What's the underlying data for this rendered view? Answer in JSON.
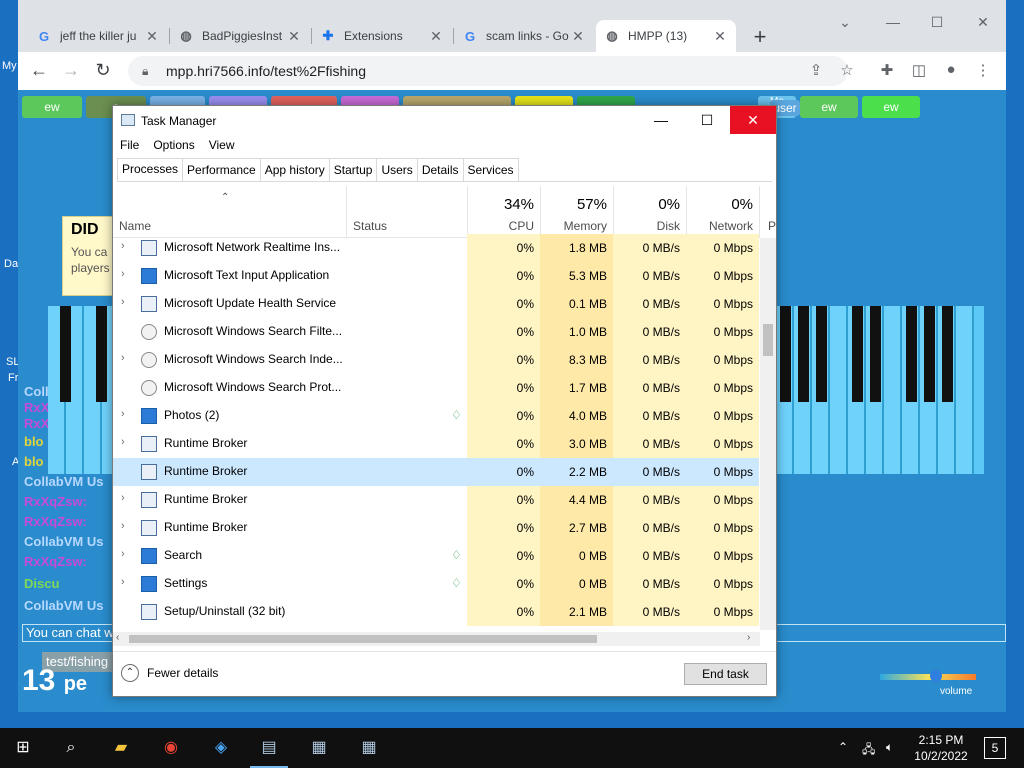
{
  "chrome": {
    "tabs": [
      {
        "title": "jeff the killer ju",
        "icon": "google-icon"
      },
      {
        "title": "BadPiggiesInst",
        "icon": "globe-icon"
      },
      {
        "title": "Extensions",
        "icon": "puzzle-icon"
      },
      {
        "title": "scam links - Go",
        "icon": "google-icon"
      },
      {
        "title": "HMPP (13)",
        "icon": "globe-icon"
      }
    ],
    "url": "mpp.hri7566.info/test%2Ffishing"
  },
  "page": {
    "top_buttons": [
      "ew",
      "e",
      "ew",
      "ew"
    ],
    "user_label": "Me",
    "user_button": "user",
    "chat_lines": [
      {
        "text": "CollabVM Us",
        "color": "#b7d8ff"
      },
      {
        "text": "RxXqZsw:",
        "color": "#c84bd8"
      },
      {
        "text": "RxXqZsw:",
        "color": "#c84bd8"
      },
      {
        "text": "blo",
        "color": "#e0d53a"
      },
      {
        "text": "blo",
        "color": "#e0d53a"
      },
      {
        "text": "blo",
        "color": "#e0d53a"
      },
      {
        "text": "CollabVM Us",
        "color": "#b7d8ff"
      },
      {
        "text": "RxXqZsw:",
        "color": "#c84bd8"
      },
      {
        "text": "RxXqZsw:",
        "color": "#c84bd8"
      },
      {
        "text": "CollabVM Us",
        "color": "#b7d8ff"
      },
      {
        "text": "RxXqZsw:",
        "color": "#c84bd8"
      },
      {
        "text": "Discu",
        "color": "#7ed957"
      },
      {
        "text": "CollabVM Us",
        "color": "#b7d8ff"
      }
    ],
    "popup_title": "DID",
    "popup_text_1": "You ca",
    "popup_text_2": "players",
    "chat_input": "You can chat w",
    "room_label": "test/fishing",
    "footer_count": "13",
    "footer_text": "pe",
    "volume_label": "volume"
  },
  "task_manager": {
    "title": "Task Manager",
    "menu": [
      "File",
      "Options",
      "View"
    ],
    "tabs": [
      "Processes",
      "Performance",
      "App history",
      "Startup",
      "Users",
      "Details",
      "Services"
    ],
    "columns": {
      "name": "Name",
      "status": "Status",
      "cpu_pct": "34%",
      "cpu": "CPU",
      "mem_pct": "57%",
      "mem": "Memory",
      "disk_pct": "0%",
      "disk": "Disk",
      "net_pct": "0%",
      "net": "Network",
      "power": "P"
    },
    "rows": [
      {
        "name": "Microsoft Network Realtime Ins...",
        "expand": true,
        "icon": "window",
        "leaf": false,
        "cpu": "0%",
        "mem": "1.8 MB",
        "disk": "0 MB/s",
        "net": "0 Mbps"
      },
      {
        "name": "Microsoft Text Input Application",
        "expand": true,
        "icon": "blue",
        "leaf": false,
        "cpu": "0%",
        "mem": "5.3 MB",
        "disk": "0 MB/s",
        "net": "0 Mbps"
      },
      {
        "name": "Microsoft Update Health Service",
        "expand": true,
        "icon": "window",
        "leaf": false,
        "cpu": "0%",
        "mem": "0.1 MB",
        "disk": "0 MB/s",
        "net": "0 Mbps"
      },
      {
        "name": "Microsoft Windows Search Filte...",
        "expand": false,
        "icon": "person",
        "leaf": false,
        "cpu": "0%",
        "mem": "1.0 MB",
        "disk": "0 MB/s",
        "net": "0 Mbps"
      },
      {
        "name": "Microsoft Windows Search Inde...",
        "expand": true,
        "icon": "person",
        "leaf": false,
        "cpu": "0%",
        "mem": "8.3 MB",
        "disk": "0 MB/s",
        "net": "0 Mbps"
      },
      {
        "name": "Microsoft Windows Search Prot...",
        "expand": false,
        "icon": "person",
        "leaf": false,
        "cpu": "0%",
        "mem": "1.7 MB",
        "disk": "0 MB/s",
        "net": "0 Mbps"
      },
      {
        "name": "Photos (2)",
        "expand": true,
        "icon": "blue",
        "leaf": true,
        "cpu": "0%",
        "mem": "4.0 MB",
        "disk": "0 MB/s",
        "net": "0 Mbps"
      },
      {
        "name": "Runtime Broker",
        "expand": true,
        "icon": "window",
        "leaf": false,
        "cpu": "0%",
        "mem": "3.0 MB",
        "disk": "0 MB/s",
        "net": "0 Mbps"
      },
      {
        "name": "Runtime Broker",
        "expand": false,
        "icon": "window",
        "leaf": false,
        "selected": true,
        "cpu": "0%",
        "mem": "2.2 MB",
        "disk": "0 MB/s",
        "net": "0 Mbps"
      },
      {
        "name": "Runtime Broker",
        "expand": true,
        "icon": "window",
        "leaf": false,
        "cpu": "0%",
        "mem": "4.4 MB",
        "disk": "0 MB/s",
        "net": "0 Mbps"
      },
      {
        "name": "Runtime Broker",
        "expand": true,
        "icon": "window",
        "leaf": false,
        "cpu": "0%",
        "mem": "2.7 MB",
        "disk": "0 MB/s",
        "net": "0 Mbps"
      },
      {
        "name": "Search",
        "expand": true,
        "icon": "blue",
        "leaf": true,
        "cpu": "0%",
        "mem": "0 MB",
        "disk": "0 MB/s",
        "net": "0 Mbps"
      },
      {
        "name": "Settings",
        "expand": true,
        "icon": "blue",
        "leaf": true,
        "cpu": "0%",
        "mem": "0 MB",
        "disk": "0 MB/s",
        "net": "0 Mbps"
      },
      {
        "name": "Setup/Uninstall (32 bit)",
        "expand": false,
        "icon": "window",
        "leaf": false,
        "cpu": "0%",
        "mem": "2.1 MB",
        "disk": "0 MB/s",
        "net": "0 Mbps"
      }
    ],
    "fewer_details": "Fewer details",
    "end_task": "End task"
  },
  "taskbar": {
    "time": "2:15 PM",
    "date": "10/2/2022",
    "notifications": "5"
  },
  "desktop": {
    "my_label": "My",
    "da_label": "Da",
    "sl_label": "SL",
    "fr_label": "Fr",
    "a_label": "A"
  }
}
